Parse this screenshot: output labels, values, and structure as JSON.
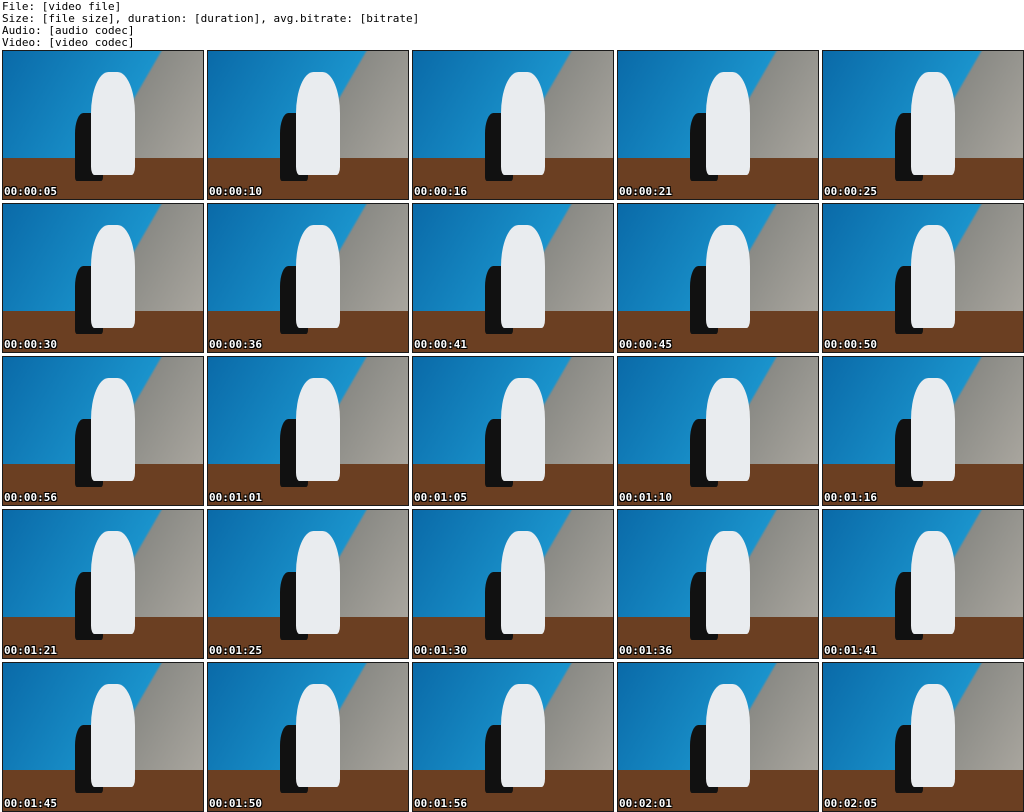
{
  "header": {
    "line1": "File: [video file]",
    "line2": "Size: [file size], duration: [duration], avg.bitrate: [bitrate]",
    "line3": "Audio: [audio codec]",
    "line4": "Video: [video codec]"
  },
  "thumbnails": [
    "00:00:05",
    "00:00:10",
    "00:00:16",
    "00:00:21",
    "00:00:25",
    "00:00:30",
    "00:00:36",
    "00:00:41",
    "00:00:45",
    "00:00:50",
    "00:00:56",
    "00:01:01",
    "00:01:05",
    "00:01:10",
    "00:01:16",
    "00:01:21",
    "00:01:25",
    "00:01:30",
    "00:01:36",
    "00:01:41",
    "00:01:45",
    "00:01:50",
    "00:01:56",
    "00:02:01",
    "00:02:05"
  ]
}
